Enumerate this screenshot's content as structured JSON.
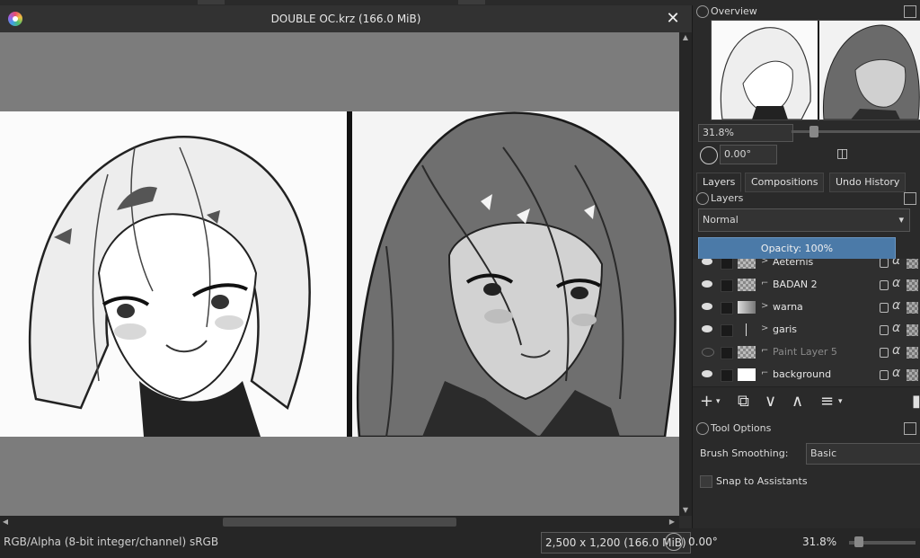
{
  "window": {
    "title": "DOUBLE OC.krz (166.0 MiB)",
    "close_glyph": "✕"
  },
  "status": {
    "color_model": "RGB/Alpha (8-bit integer/channel)  sRGB",
    "image_size": "2,500 x 1,200 (166.0 MiB)",
    "rotation": "0.00°",
    "zoom": "31.8%"
  },
  "overview": {
    "title": "Overview",
    "zoom": "31.8%",
    "rotation": "0.00°"
  },
  "tabs": [
    {
      "label": "Layers",
      "active": true
    },
    {
      "label": "Compositions",
      "active": false
    },
    {
      "label": "Undo History",
      "active": false
    }
  ],
  "layers_panel": {
    "title": "Layers",
    "blend_mode": "Normal",
    "opacity": "Opacity:  100%",
    "layers": [
      {
        "name": "Aeternis",
        "visible": true,
        "kind": "group",
        "thumb": "checker"
      },
      {
        "name": "BADAN 2",
        "visible": true,
        "kind": "paint",
        "thumb": "checker"
      },
      {
        "name": "warna",
        "visible": true,
        "kind": "group",
        "thumb": "art"
      },
      {
        "name": "garis",
        "visible": true,
        "kind": "group",
        "thumb": "line"
      },
      {
        "name": "Paint Layer 5",
        "visible": false,
        "kind": "paint",
        "thumb": "checker"
      },
      {
        "name": "background",
        "visible": true,
        "kind": "paint",
        "thumb": "white"
      }
    ]
  },
  "tool_options": {
    "title": "Tool Options",
    "brush_smoothing_label": "Brush Smoothing:",
    "brush_smoothing_value": "Basic",
    "snap_label": "Snap to Assistants",
    "snap_checked": false
  }
}
